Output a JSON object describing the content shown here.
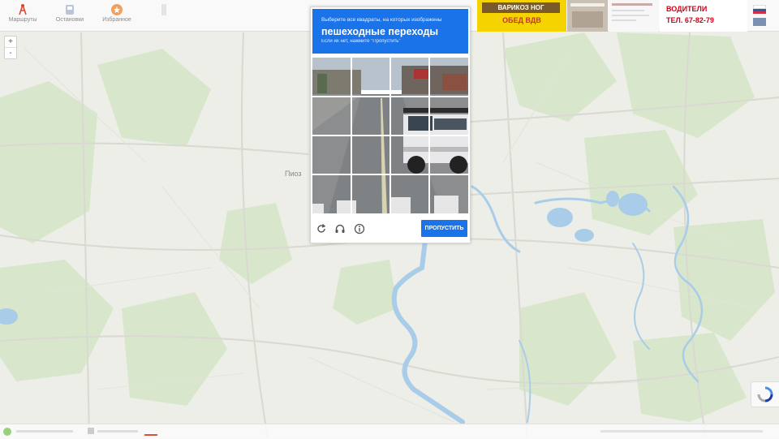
{
  "nav": {
    "route_label": "Маршруты",
    "stops_label": "Остановки",
    "favorites_label": "Избранное"
  },
  "captcha": {
    "instruction": "Выберите все квадраты, на которых изображены",
    "target": "пешеходные переходы",
    "hint": "Если их нет, нажмите \"Пропустить\"",
    "skip_label": "ПРОПУСТИТЬ",
    "reload_icon": "reload-icon",
    "audio_icon": "headphones-icon",
    "info_icon": "info-icon",
    "accent": "#1a73e8"
  },
  "ads": {
    "ad1_line1": "ВАРИКОЗ НОГ",
    "ad1_line2": "ОБЕД ВДВ",
    "ad3_line1": "ВОДИТЕЛИ",
    "ad3_line2": "ТЕЛ. 67-82-79"
  },
  "map": {
    "city_label": "Пиоз"
  },
  "zoom": {
    "in": "+",
    "out": "-"
  }
}
